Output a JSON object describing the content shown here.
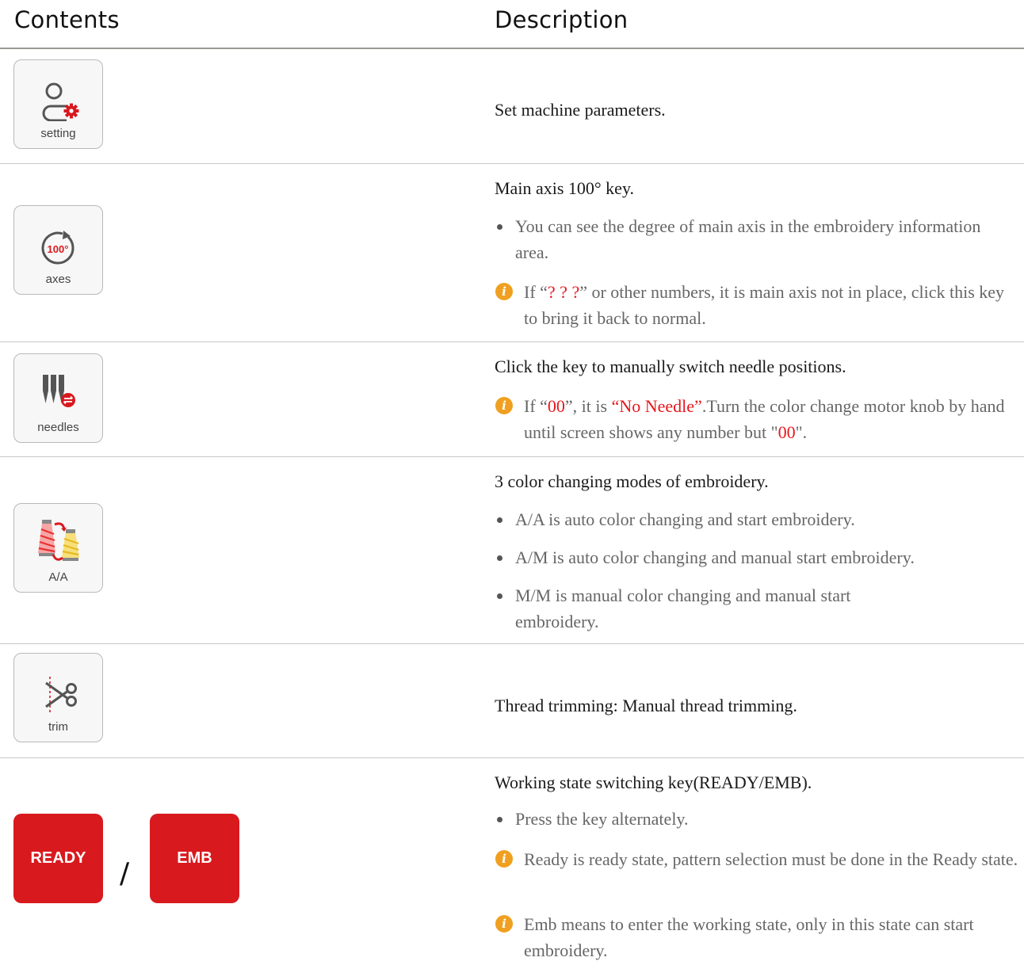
{
  "header": {
    "contents": "Contents",
    "description": "Description"
  },
  "rows": [
    {
      "key_label": "setting",
      "icon": "user-gear-icon",
      "title": "Set machine parameters."
    },
    {
      "key_label": "axes",
      "icon": "rotate-100-icon",
      "icon_text": "100°",
      "title": "Main axis 100° key.",
      "bullet": "You can see the degree of main axis in the embroidery information area.",
      "info_pre": "If “",
      "info_red": "? ? ?",
      "info_post": "” or other numbers, it is main axis not in place, click this key to bring it back to normal."
    },
    {
      "key_label": "needles",
      "icon": "needles-switch-icon",
      "title": "Click the key to manually switch needle positions.",
      "info_a": "If “",
      "info_red1": "00",
      "info_b": "”,  it is ",
      "info_red2": "“No Needle”",
      "info_c": ".Turn the color change motor knob by hand until screen shows any number but \"",
      "info_red3": "00",
      "info_d": "\"."
    },
    {
      "key_label": "A/A",
      "icon": "thread-cones-swap-icon",
      "title": "3 color changing modes of embroidery.",
      "bullets": [
        "A/A is auto color changing and start embroidery.",
        "A/M is auto color changing and manual start embroidery.",
        "M/M is manual color changing and manual start embroidery."
      ]
    },
    {
      "key_label": "trim",
      "icon": "scissors-icon",
      "title": "Thread trimming: Manual thread trimming."
    },
    {
      "ready_label": "READY",
      "slash": "/",
      "emb_label": "EMB",
      "title": "Working state switching key(READY/EMB).",
      "bullet": "Press the key alternately.",
      "infos": [
        "Ready is ready state, pattern selection must be done in the Ready state.",
        "Emb means to enter the working state, only in this state can start embroidery."
      ]
    }
  ],
  "colors": {
    "accent_red": "#d8191e",
    "info_orange": "#f0a020",
    "divider": "#c8c8c8"
  }
}
